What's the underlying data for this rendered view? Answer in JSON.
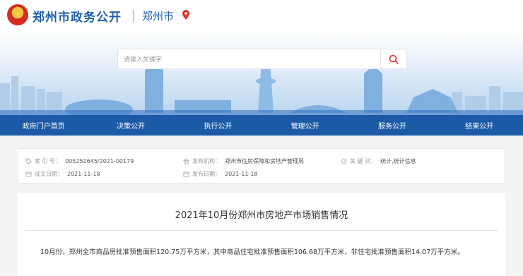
{
  "header": {
    "site_title": "郑州市政务公开",
    "city": "郑州市",
    "search_placeholder": "请输入关键字"
  },
  "nav": [
    "政府门户首页",
    "决策公开",
    "执行公开",
    "管理公开",
    "服务公开",
    "结果公开"
  ],
  "meta": {
    "index_label": "索 引 号：",
    "index_value": "005252645/2021-00179",
    "publisher_label": "发布机构：",
    "publisher_value": "郑州市住房保障和房地产管理局",
    "keywords_label": "关 键 词：",
    "keywords_value": "统计,统计信息",
    "created_label": "成文日期：",
    "created_value": "2021-11-18",
    "published_label": "发布日期：",
    "published_value": "2021-11-18"
  },
  "article": {
    "title": "2021年10月份郑州市房地产市场销售情况",
    "body": "10月份，郑州全市商品房批准预售面积120.75万平方米，其中商品住宅批准预售面积106.68万平方米，非住宅批准预售面积14.07万平方米。"
  },
  "colors": {
    "brand_blue": "#1f5fad",
    "nav_blue": "#1b5ba6",
    "pin_red": "#e0322b",
    "search_red": "#d9342b"
  }
}
